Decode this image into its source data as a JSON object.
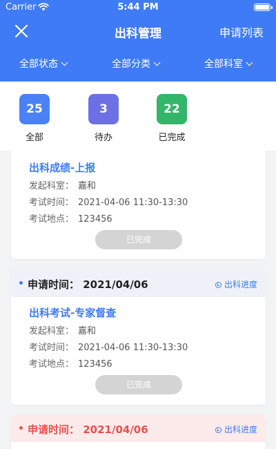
{
  "status_bar": {
    "carrier": "Carrier",
    "time": "5:44 PM"
  },
  "nav": {
    "title": "出科管理",
    "right_label": "申请列表"
  },
  "filters": [
    "全部状态",
    "全部分类",
    "全部科室"
  ],
  "stats": [
    {
      "value": "25",
      "label": "全部",
      "color": "#4a82f5"
    },
    {
      "value": "3",
      "label": "待办",
      "color": "#6d70e4"
    },
    {
      "value": "22",
      "label": "已完成",
      "color": "#33b56a"
    }
  ],
  "cards": [
    {
      "title": "出科成绩-上报",
      "rows": [
        {
          "key": "发起科室：",
          "value": "嘉和"
        },
        {
          "key": "考试时间：",
          "value": "2021-04-06 11:30-13:30"
        },
        {
          "key": "考试地点：",
          "value": "123456"
        }
      ],
      "button": "已完成"
    },
    {
      "apply_time": "申请时间：  2021/04/06",
      "progress": "出科进度",
      "title": "出科考试-专家督查",
      "rows": [
        {
          "key": "发起科室：",
          "value": "嘉和"
        },
        {
          "key": "考试时间：",
          "value": "2021-04-06 11:30-13:30"
        },
        {
          "key": "考试地点：",
          "value": "123456"
        }
      ],
      "button": "已完成"
    },
    {
      "apply_time": "申请时间：  2021/04/06",
      "progress": "出科进度"
    }
  ]
}
